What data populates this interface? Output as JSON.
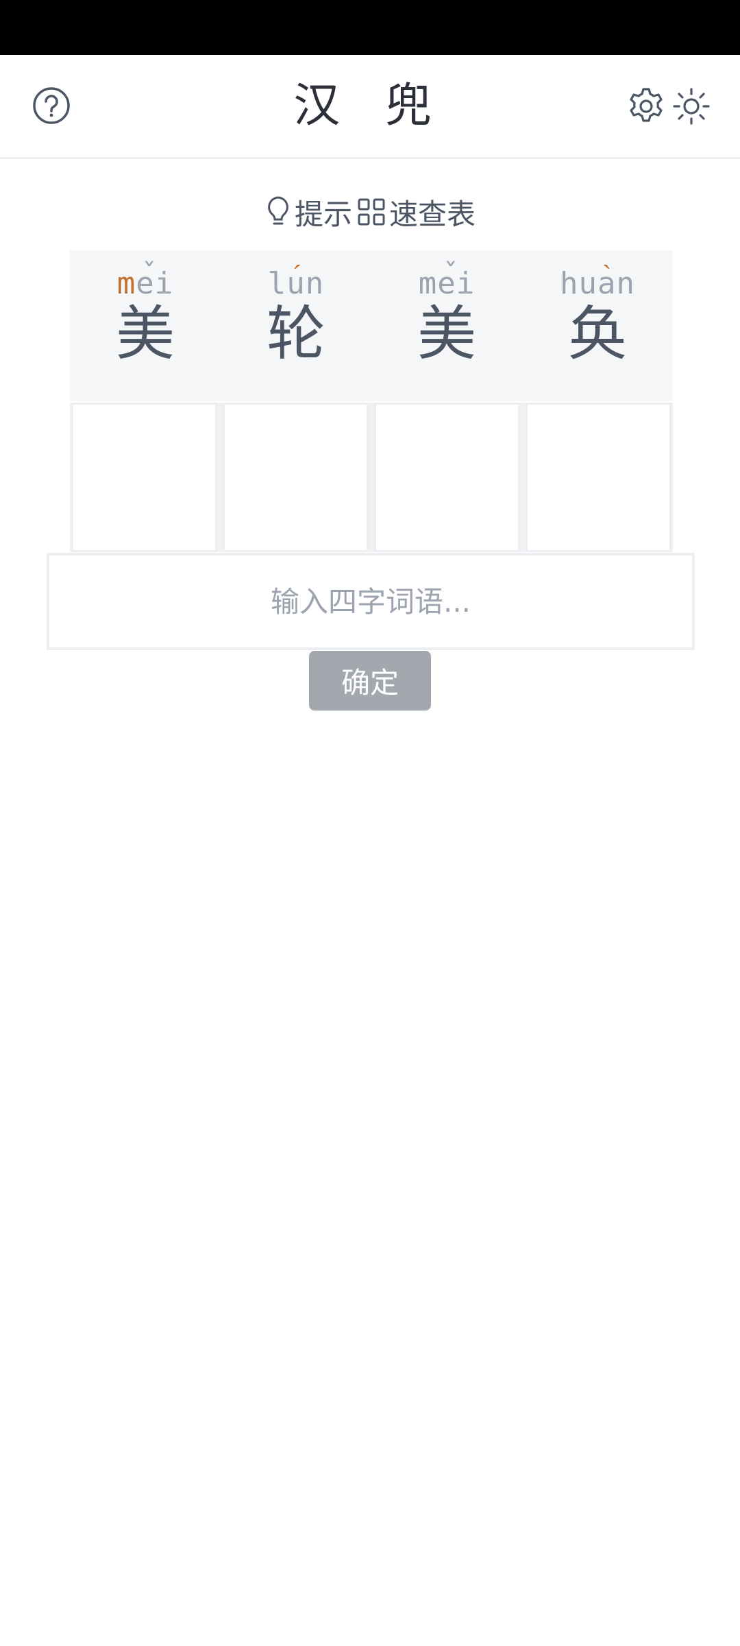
{
  "header": {
    "title": "汉 兜",
    "help_icon": "question-circle-icon",
    "settings_icon": "gear-icon",
    "theme_icon": "sun-icon"
  },
  "toolbar": {
    "hint_label": "提示",
    "hint_icon": "lightbulb-icon",
    "table_label": "速查表",
    "table_icon": "grid-icon"
  },
  "puzzle": {
    "cells": [
      {
        "initial": "m",
        "final": "ei",
        "tone_mark": "ˇ",
        "hanzi": "美",
        "initial_match": true,
        "tone_match": false
      },
      {
        "initial": "l",
        "final": "un",
        "tone_mark": "ˊ",
        "hanzi": "轮",
        "initial_match": false,
        "tone_match": true
      },
      {
        "initial": "m",
        "final": "ei",
        "tone_mark": "ˇ",
        "hanzi": "美",
        "initial_match": false,
        "tone_match": false
      },
      {
        "initial": "h",
        "final": "uan",
        "tone_mark": "ˋ",
        "hanzi": "奂",
        "initial_match": false,
        "tone_match": true
      }
    ],
    "highlight_color": "#c2702c",
    "muted_color": "#9ca3af"
  },
  "input": {
    "placeholder": "输入四字词语...",
    "value": ""
  },
  "confirm_label": "确定"
}
